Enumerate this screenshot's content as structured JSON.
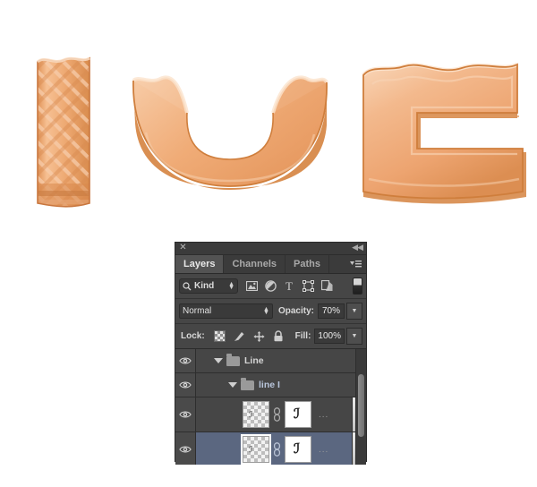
{
  "artwork": {
    "description": "Three candy-like letters rendered in orange glaze",
    "letters": [
      {
        "char": "I",
        "style": "waffle-lattice-texture",
        "color": "#e8a068"
      },
      {
        "char": "U",
        "style": "smooth-glaze",
        "color": "#f0b183"
      },
      {
        "char": "C",
        "style": "smooth-glaze-bevel",
        "color": "#f0b183"
      }
    ],
    "colors": {
      "glaze_light": "#f8d2b4",
      "glaze_mid": "#f0ab77",
      "glaze_dark": "#d8854a",
      "outline": "#c9773f"
    }
  },
  "panel": {
    "close_label": "✕",
    "collapse_label": "◀◀",
    "tabs": [
      {
        "label": "Layers",
        "active": true
      },
      {
        "label": "Channels",
        "active": false
      },
      {
        "label": "Paths",
        "active": false
      }
    ],
    "menu_icon": "panel-menu-icon",
    "filter": {
      "search_icon": "search-icon",
      "kind_label": "Kind",
      "icons": [
        {
          "name": "pixel-layer-filter-icon",
          "glyph": "image"
        },
        {
          "name": "adjustment-layer-filter-icon",
          "glyph": "circle-slash"
        },
        {
          "name": "type-layer-filter-icon",
          "glyph": "T"
        },
        {
          "name": "shape-layer-filter-icon",
          "glyph": "shape"
        },
        {
          "name": "smart-object-filter-icon",
          "glyph": "smart"
        }
      ],
      "toggle_name": "filter-enable-toggle"
    },
    "blend": {
      "mode": "Normal",
      "opacity_label": "Opacity:",
      "opacity_value": "70%",
      "fill_label": "Fill:",
      "fill_value": "100%"
    },
    "lock": {
      "label": "Lock:",
      "icons": [
        {
          "name": "lock-transparent-pixels-icon"
        },
        {
          "name": "lock-image-pixels-icon"
        },
        {
          "name": "lock-position-icon"
        },
        {
          "name": "lock-all-icon"
        }
      ]
    },
    "layers": [
      {
        "type": "group",
        "name": "Line",
        "indent": 0,
        "expanded": true,
        "visible": true,
        "selected": false,
        "highlight": false
      },
      {
        "type": "group",
        "name": "line I",
        "indent": 1,
        "expanded": true,
        "visible": true,
        "selected": false,
        "highlight": true
      },
      {
        "type": "layer",
        "name": "",
        "indent": 2,
        "visible": true,
        "selected": false,
        "thumb_glyph": "ℐ",
        "mask_glyph": "ℐ",
        "has_link": true,
        "has_mask": true,
        "more": "...",
        "fx_arrow": "▼"
      },
      {
        "type": "layer",
        "name": "",
        "indent": 2,
        "visible": true,
        "selected": true,
        "thumb_glyph": "ℐ",
        "mask_glyph": "ℐ",
        "has_link": true,
        "has_mask": true,
        "more": "...",
        "fx_arrow": "▼"
      }
    ],
    "scrollbar": {
      "name": "layers-vertical-scrollbar"
    },
    "colors": {
      "panel_bg": "#3b3b3b",
      "row_bg": "#464646",
      "row_selected": "#5b6780",
      "text": "#d5d5d5",
      "accent_text": "#b9c6dc"
    }
  }
}
